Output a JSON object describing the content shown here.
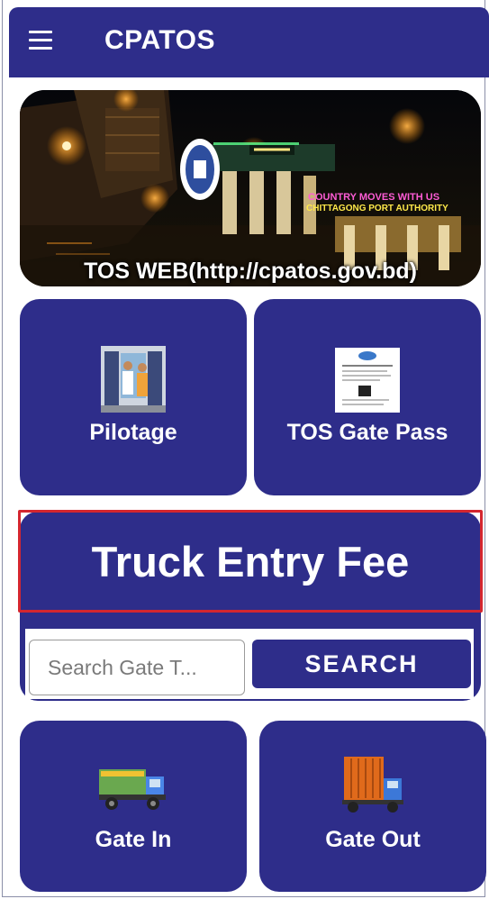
{
  "appbar": {
    "title": "CPATOS"
  },
  "banner": {
    "caption": "TOS WEB(http://cpatos.gov.bd)",
    "sign_line_1": "COUNTRY MOVES WITH US",
    "sign_line_2": "CHITTAGONG PORT AUTHORITY"
  },
  "tiles": {
    "pilotage": {
      "label": "Pilotage",
      "icon": "pilotage-icon"
    },
    "gate_pass": {
      "label": "TOS Gate Pass",
      "icon": "gate-pass-icon"
    },
    "gate_in": {
      "label": "Gate In",
      "icon": "truck-icon"
    },
    "gate_out": {
      "label": "Gate Out",
      "icon": "container-truck-icon"
    }
  },
  "fee_card": {
    "title": "Truck Entry Fee",
    "search_placeholder": "Search Gate T...",
    "search_button": "SEARCH"
  },
  "colors": {
    "primary": "#2e2d8a",
    "highlight": "#d4262f"
  }
}
